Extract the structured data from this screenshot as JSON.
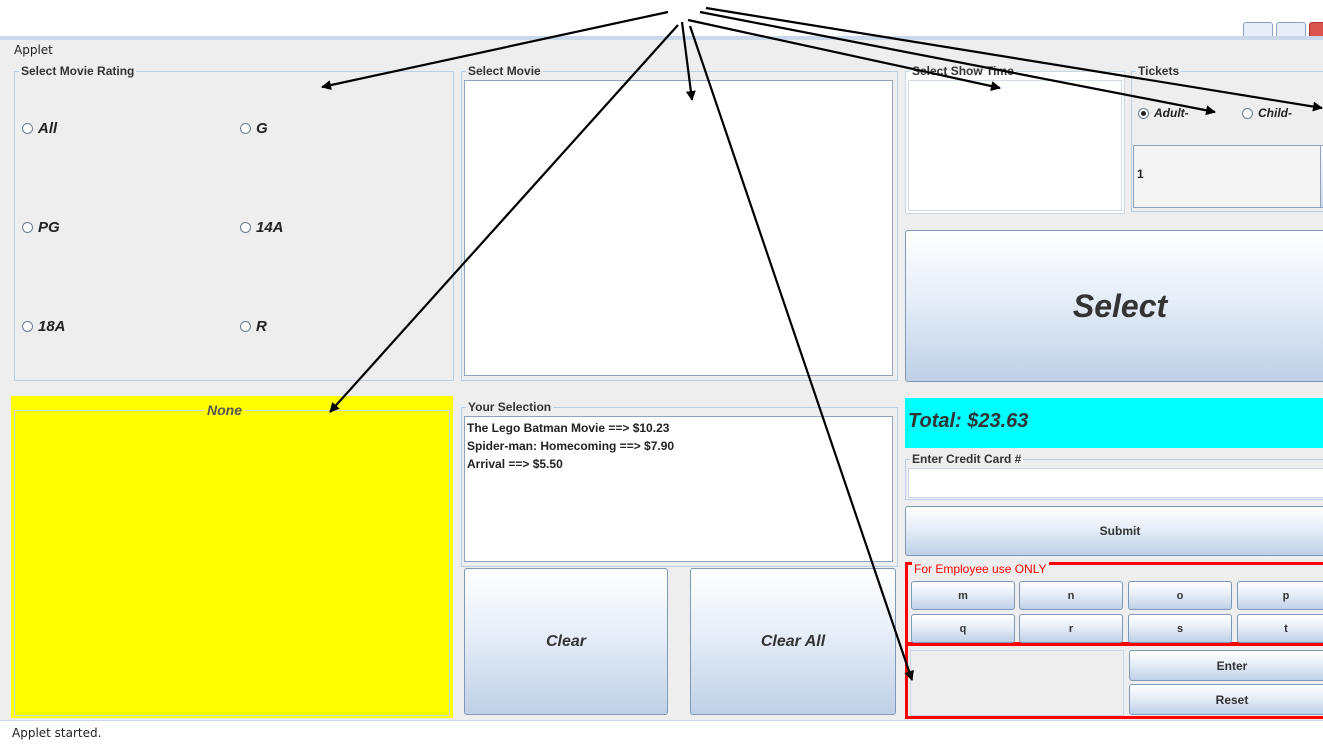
{
  "window": {
    "title": "Applet"
  },
  "rating_panel": {
    "legend": "Select Movie Rating",
    "options": [
      {
        "label": "All"
      },
      {
        "label": "G"
      },
      {
        "label": "PG"
      },
      {
        "label": "14A"
      },
      {
        "label": "18A"
      },
      {
        "label": "R"
      }
    ]
  },
  "movie_panel": {
    "legend": "Select Movie"
  },
  "showtime_panel": {
    "legend": "Select Show Time"
  },
  "tickets_panel": {
    "legend": "Tickets",
    "adult_label": "Adult-",
    "child_label": "Child-",
    "quantity": "1"
  },
  "select_button": {
    "label": "Select"
  },
  "poster_panel": {
    "legend": "None",
    "bg_color": "#ffff00"
  },
  "selection_panel": {
    "legend": "Your Selection",
    "items": [
      "The Lego Batman Movie ==> $10.23",
      "Spider-man: Homecoming ==> $7.90",
      "Arrival ==> $5.50"
    ]
  },
  "clear_button": {
    "label": "Clear"
  },
  "clear_all_button": {
    "label": "Clear All"
  },
  "total": {
    "text": "Total: $23.63",
    "bg_color": "#00ffff"
  },
  "credit_card": {
    "legend": "Enter Credit Card #",
    "value": ""
  },
  "submit_button": {
    "label": "Submit"
  },
  "employee_panel": {
    "legend": "For Employee use ONLY",
    "color": "#ff0000",
    "keys_row1": [
      "m",
      "n",
      "o",
      "p"
    ],
    "keys_row2": [
      "q",
      "r",
      "s",
      "t"
    ],
    "enter_label": "Enter",
    "reset_label": "Reset"
  },
  "status_bar": {
    "text": "Applet started."
  }
}
